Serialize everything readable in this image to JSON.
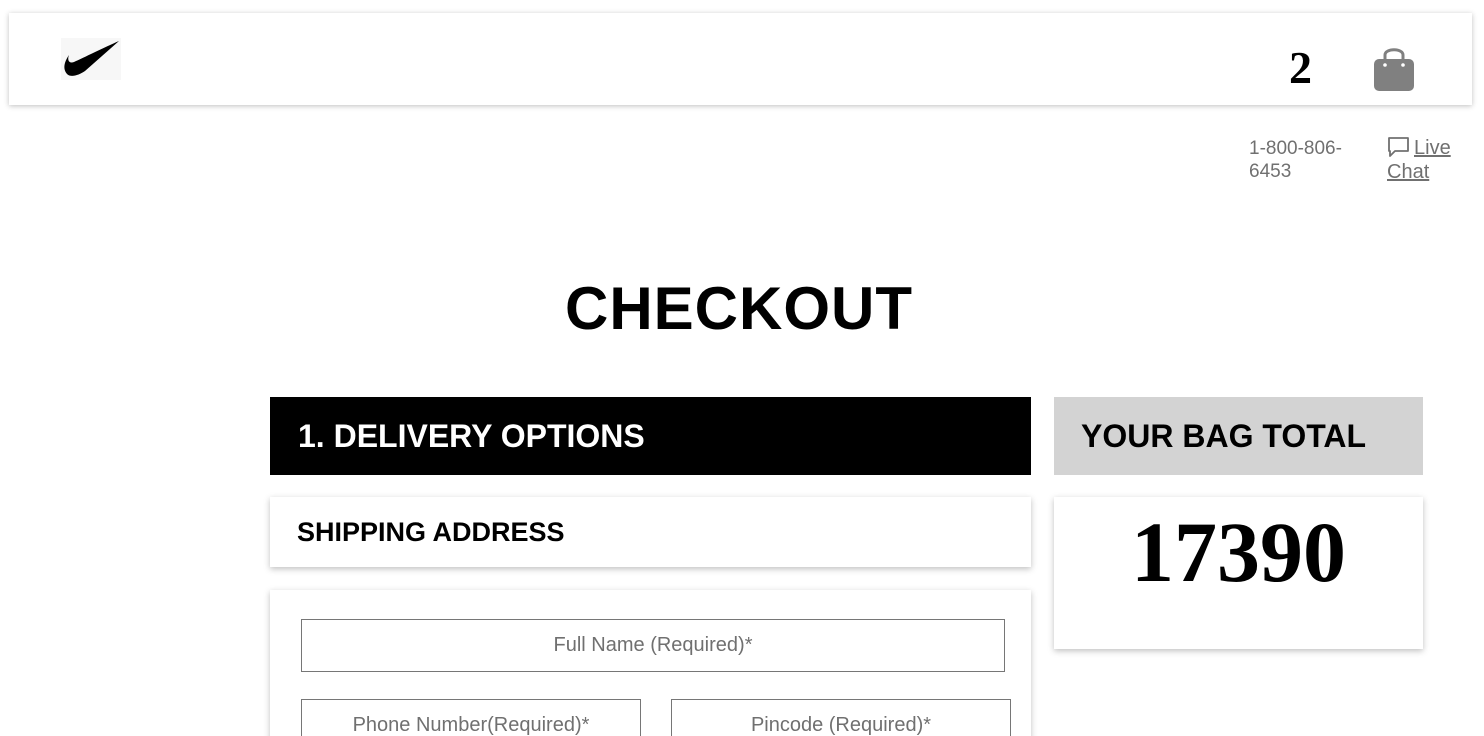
{
  "header": {
    "logo_icon": "swoosh-logo",
    "cart_count": "2",
    "bag_icon": "shopping-bag-icon",
    "bag_icon_color": "#808080"
  },
  "contact": {
    "phone": "1-800-806-6453",
    "chat_icon": "chat-bubble-icon",
    "live_chat_label": "Live Chat"
  },
  "page": {
    "title": "CHECKOUT"
  },
  "delivery": {
    "section_title": "1. DELIVERY OPTIONS",
    "shipping_title": "SHIPPING ADDRESS",
    "fields": {
      "full_name_placeholder": "Full Name (Required)*",
      "phone_placeholder": "Phone Number(Required)*",
      "pincode_placeholder": "Pincode (Required)*"
    }
  },
  "bag": {
    "title": "YOUR BAG TOTAL",
    "total": "17390"
  },
  "colors": {
    "section_header_bg": "#000000",
    "bag_header_bg": "#d3d3d3",
    "muted_text": "#707070"
  }
}
